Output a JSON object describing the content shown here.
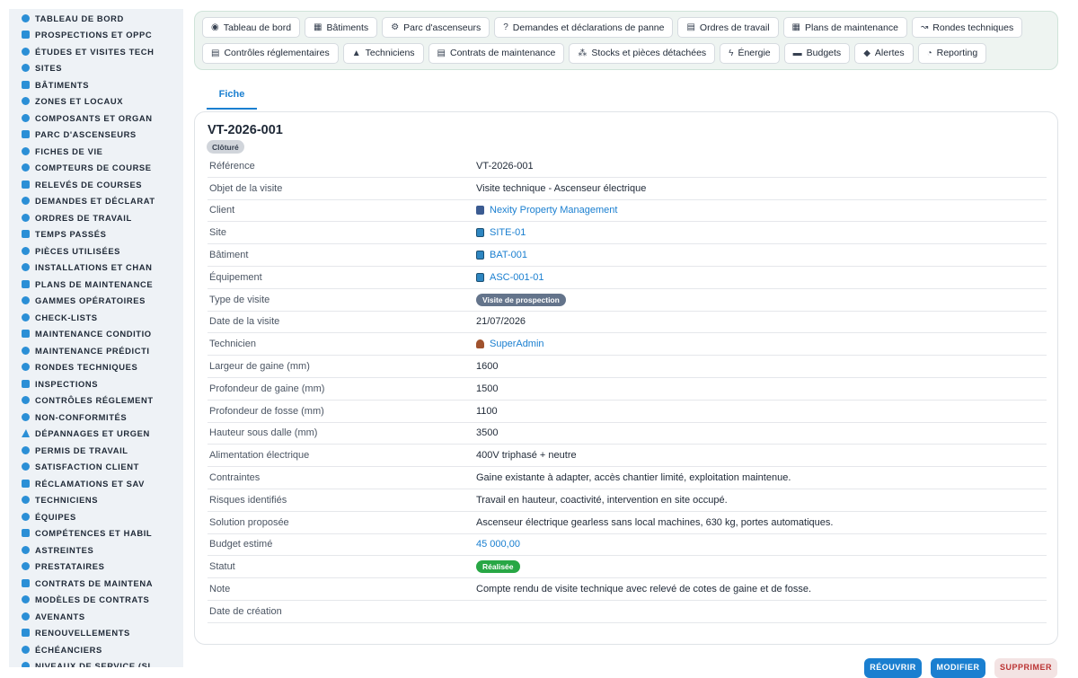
{
  "sidebar": {
    "items": [
      {
        "label": "TABLEAU DE BORD",
        "icon": "dashboard-icon"
      },
      {
        "label": "PROSPECTIONS ET OPPC",
        "icon": "target-icon"
      },
      {
        "label": "ÉTUDES ET VISITES TECH",
        "icon": "ruler-icon"
      },
      {
        "label": "SITES",
        "icon": "pin-icon"
      },
      {
        "label": "BÂTIMENTS",
        "icon": "building-icon"
      },
      {
        "label": "ZONES ET LOCAUX",
        "icon": "floorplan-icon"
      },
      {
        "label": "COMPOSANTS ET ORGAN",
        "icon": "sitemap-icon"
      },
      {
        "label": "PARC D'ASCENSEURS",
        "icon": "gears-icon"
      },
      {
        "label": "FICHES DE VIE",
        "icon": "history-icon"
      },
      {
        "label": "COMPTEURS DE COURSE",
        "icon": "gauge-icon"
      },
      {
        "label": "RELEVÉS DE COURSES",
        "icon": "list-icon"
      },
      {
        "label": "DEMANDES ET DÉCLARAT",
        "icon": "question-icon"
      },
      {
        "label": "ORDRES DE TRAVAIL",
        "icon": "clipboard-icon"
      },
      {
        "label": "TEMPS PASSÉS",
        "icon": "clock-icon"
      },
      {
        "label": "PIÈCES UTILISÉES",
        "icon": "parts-icon"
      },
      {
        "label": "INSTALLATIONS ET CHAN",
        "icon": "hammer-icon"
      },
      {
        "label": "PLANS DE MAINTENANCE",
        "icon": "calendar-icon"
      },
      {
        "label": "GAMMES OPÉRATOIRES",
        "icon": "list-icon"
      },
      {
        "label": "CHECK-LISTS",
        "icon": "checklist-icon"
      },
      {
        "label": "MAINTENANCE CONDITIO",
        "icon": "thermometer-icon"
      },
      {
        "label": "MAINTENANCE PRÉDICTI",
        "icon": "chart-icon"
      },
      {
        "label": "RONDES TECHNIQUES",
        "icon": "route-icon"
      },
      {
        "label": "INSPECTIONS",
        "icon": "search-icon"
      },
      {
        "label": "CONTRÔLES RÉGLEMENT",
        "icon": "clipboard-check-icon"
      },
      {
        "label": "NON-CONFORMITÉS",
        "icon": "alert-icon"
      },
      {
        "label": "DÉPANNAGES ET URGEN",
        "icon": "warning-icon"
      },
      {
        "label": "PERMIS DE TRAVAIL",
        "icon": "file-icon"
      },
      {
        "label": "SATISFACTION CLIENT",
        "icon": "smile-icon"
      },
      {
        "label": "RÉCLAMATIONS ET SAV",
        "icon": "comment-icon"
      },
      {
        "label": "TECHNICIENS",
        "icon": "helmet-icon"
      },
      {
        "label": "ÉQUIPES",
        "icon": "users-icon"
      },
      {
        "label": "COMPÉTENCES ET HABIL",
        "icon": "certificate-icon"
      },
      {
        "label": "ASTREINTES",
        "icon": "phone-icon"
      },
      {
        "label": "PRESTATAIRES",
        "icon": "handshake-icon"
      },
      {
        "label": "CONTRATS DE MAINTENA",
        "icon": "contract-icon"
      },
      {
        "label": "MODÈLES DE CONTRATS",
        "icon": "file-icon"
      },
      {
        "label": "AVENANTS",
        "icon": "edit-icon"
      },
      {
        "label": "RENOUVELLEMENTS",
        "icon": "refresh-icon"
      },
      {
        "label": "ÉCHÉANCIERS",
        "icon": "file-icon"
      },
      {
        "label": "NIVEAUX DE SERVICE (SL",
        "icon": "shield-icon"
      }
    ]
  },
  "topnav": [
    {
      "label": "Tableau de bord",
      "icon": "dashboard-icon",
      "glyph": "◉"
    },
    {
      "label": "Bâtiments",
      "icon": "building-icon",
      "glyph": "▦"
    },
    {
      "label": "Parc d'ascenseurs",
      "icon": "gears-icon",
      "glyph": "⚙"
    },
    {
      "label": "Demandes et déclarations de panne",
      "icon": "question-icon",
      "glyph": "?"
    },
    {
      "label": "Ordres de travail",
      "icon": "clipboard-icon",
      "glyph": "▤"
    },
    {
      "label": "Plans de maintenance",
      "icon": "calendar-icon",
      "glyph": "▦"
    },
    {
      "label": "Rondes techniques",
      "icon": "route-icon",
      "glyph": "↝"
    },
    {
      "label": "Contrôles réglementaires",
      "icon": "clipboard-check-icon",
      "glyph": "▤"
    },
    {
      "label": "Techniciens",
      "icon": "helmet-icon",
      "glyph": "▲"
    },
    {
      "label": "Contrats de maintenance",
      "icon": "contract-icon",
      "glyph": "▤"
    },
    {
      "label": "Stocks et pièces détachées",
      "icon": "parts-icon",
      "glyph": "⁂"
    },
    {
      "label": "Énergie",
      "icon": "bolt-icon",
      "glyph": "ϟ"
    },
    {
      "label": "Budgets",
      "icon": "money-icon",
      "glyph": "▬"
    },
    {
      "label": "Alertes",
      "icon": "bell-icon",
      "glyph": "◆"
    },
    {
      "label": "Reporting",
      "icon": "pie-icon",
      "glyph": "◔"
    }
  ],
  "tabs": {
    "fiche": "Fiche"
  },
  "record": {
    "title": "VT-2026-001",
    "status_badge": "Clôturé",
    "fields": [
      {
        "label": "Référence",
        "value": "VT-2026-001",
        "kind": "text"
      },
      {
        "label": "Objet de la visite",
        "value": "Visite technique - Ascenseur électrique",
        "kind": "text"
      },
      {
        "label": "Client",
        "value": "Nexity Property Management",
        "kind": "link",
        "icon": "building-icon"
      },
      {
        "label": "Site",
        "value": "SITE-01",
        "kind": "link",
        "icon": "site-icon"
      },
      {
        "label": "Bâtiment",
        "value": "BAT-001",
        "kind": "link",
        "icon": "site-icon"
      },
      {
        "label": "Équipement",
        "value": "ASC-001-01",
        "kind": "link",
        "icon": "site-icon"
      },
      {
        "label": "Type de visite",
        "value": "Visite de prospection",
        "kind": "pill-dark"
      },
      {
        "label": "Date de la visite",
        "value": "21/07/2026",
        "kind": "text"
      },
      {
        "label": "Technicien",
        "value": "SuperAdmin",
        "kind": "link",
        "icon": "user-icon"
      },
      {
        "label": "Largeur de gaine (mm)",
        "value": "1600",
        "kind": "text"
      },
      {
        "label": "Profondeur de gaine (mm)",
        "value": "1500",
        "kind": "text"
      },
      {
        "label": "Profondeur de fosse (mm)",
        "value": "1100",
        "kind": "text"
      },
      {
        "label": "Hauteur sous dalle (mm)",
        "value": "3500",
        "kind": "text"
      },
      {
        "label": "Alimentation électrique",
        "value": "400V triphasé + neutre",
        "kind": "text"
      },
      {
        "label": "Contraintes",
        "value": "Gaine existante à adapter, accès chantier limité, exploitation maintenue.",
        "kind": "text"
      },
      {
        "label": "Risques identifiés",
        "value": "Travail en hauteur, coactivité, intervention en site occupé.",
        "kind": "text"
      },
      {
        "label": "Solution proposée",
        "value": "Ascenseur électrique gearless sans local machines, 630 kg, portes automatiques.",
        "kind": "text"
      },
      {
        "label": "Budget estimé",
        "value": "45 000,00",
        "kind": "money"
      },
      {
        "label": "Statut",
        "value": "Réalisée",
        "kind": "pill-green"
      },
      {
        "label": "Note",
        "value": "Compte rendu de visite technique avec relevé de cotes de gaine et de fosse.",
        "kind": "text"
      },
      {
        "label": "Date de création",
        "value": "",
        "kind": "text"
      }
    ]
  },
  "actions": {
    "reouvrir": "RÉOUVRIR",
    "modifier": "MODIFIER",
    "supprimer": "SUPPRIMER"
  }
}
